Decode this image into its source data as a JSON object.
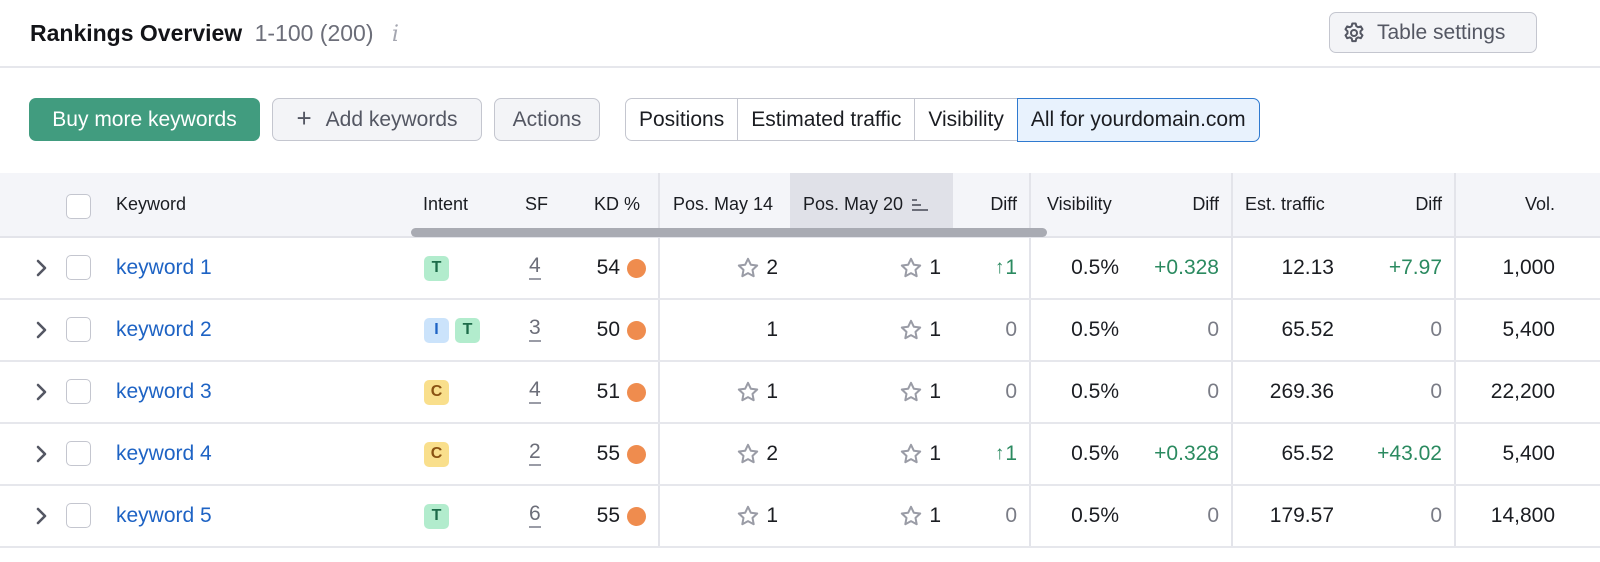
{
  "header": {
    "title": "Rankings Overview",
    "range": "1-100 (200)",
    "info_icon": "i",
    "table_settings_label": "Table settings"
  },
  "toolbar": {
    "buy_label": "Buy more keywords",
    "add_label": "Add keywords",
    "add_icon": "+",
    "actions_label": "Actions",
    "segments": [
      {
        "label": "Positions",
        "active": false
      },
      {
        "label": "Estimated traffic",
        "active": false
      },
      {
        "label": "Visibility",
        "active": false
      },
      {
        "label": "All for yourdomain.com",
        "active": true
      }
    ]
  },
  "table": {
    "columns": {
      "keyword": "Keyword",
      "intent": "Intent",
      "sf": "SF",
      "kd": "KD %",
      "pos1": "Pos. May 14",
      "pos2": "Pos. May 20",
      "pos_diff": "Diff",
      "visibility": "Visibility",
      "vis_diff": "Diff",
      "traffic": "Est. traffic",
      "traffic_diff": "Diff",
      "volume": "Vol."
    },
    "colors": {
      "accent": "#419c7f",
      "link": "#1e63c4",
      "positive": "#2b8a60",
      "kd_dot": "#ef8c4e"
    },
    "rows": [
      {
        "keyword": "keyword 1",
        "intent": [
          "T"
        ],
        "sf": "4",
        "kd": "54",
        "pos1": "2",
        "pos1_star": true,
        "pos2": "1",
        "pos2_star": true,
        "pos_diff": "1",
        "pos_diff_up": true,
        "visibility": "0.5%",
        "vis_diff": "+0.328",
        "traffic": "12.13",
        "traffic_diff": "+7.97",
        "volume": "1,000"
      },
      {
        "keyword": "keyword 2",
        "intent": [
          "I",
          "T"
        ],
        "sf": "3",
        "kd": "50",
        "pos1": "1",
        "pos1_star": false,
        "pos2": "1",
        "pos2_star": true,
        "pos_diff": "0",
        "pos_diff_up": false,
        "visibility": "0.5%",
        "vis_diff": "0",
        "traffic": "65.52",
        "traffic_diff": "0",
        "volume": "5,400"
      },
      {
        "keyword": "keyword 3",
        "intent": [
          "C"
        ],
        "sf": "4",
        "kd": "51",
        "pos1": "1",
        "pos1_star": true,
        "pos2": "1",
        "pos2_star": true,
        "pos_diff": "0",
        "pos_diff_up": false,
        "visibility": "0.5%",
        "vis_diff": "0",
        "traffic": "269.36",
        "traffic_diff": "0",
        "volume": "22,200"
      },
      {
        "keyword": "keyword 4",
        "intent": [
          "C"
        ],
        "sf": "2",
        "kd": "55",
        "pos1": "2",
        "pos1_star": true,
        "pos2": "1",
        "pos2_star": true,
        "pos_diff": "1",
        "pos_diff_up": true,
        "visibility": "0.5%",
        "vis_diff": "+0.328",
        "traffic": "65.52",
        "traffic_diff": "+43.02",
        "volume": "5,400"
      },
      {
        "keyword": "keyword 5",
        "intent": [
          "T"
        ],
        "sf": "6",
        "kd": "55",
        "pos1": "1",
        "pos1_star": true,
        "pos2": "1",
        "pos2_star": true,
        "pos_diff": "0",
        "pos_diff_up": false,
        "visibility": "0.5%",
        "vis_diff": "0",
        "traffic": "179.57",
        "traffic_diff": "0",
        "volume": "14,800"
      }
    ]
  }
}
